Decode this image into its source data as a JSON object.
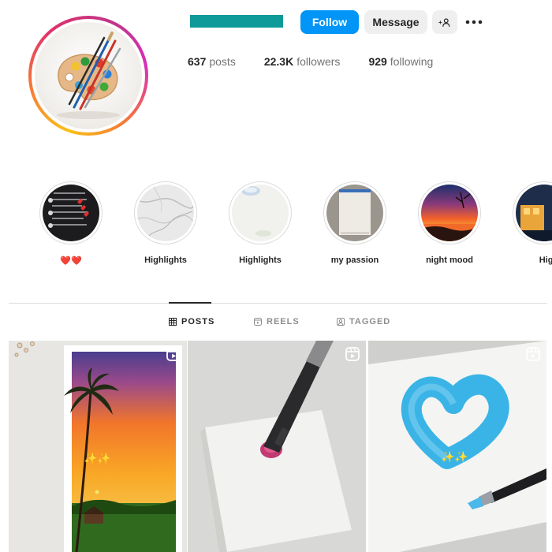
{
  "header": {
    "follow_label": "Follow",
    "message_label": "Message",
    "suggest_icon": "add-user-icon",
    "more_icon": "more-options-icon",
    "avatar_icon": "paint-palette-icon",
    "username_color": "#0f9a9a",
    "accent": "#0095f6"
  },
  "stats": {
    "posts": {
      "value": "637",
      "label": "posts"
    },
    "followers": {
      "value": "22.3K",
      "label": "followers"
    },
    "following": {
      "value": "929",
      "label": "following"
    }
  },
  "highlights": [
    {
      "label": "❤️❤️",
      "cover": "app-screenshot"
    },
    {
      "label": "Highlights",
      "cover": "marble"
    },
    {
      "label": "Highlights",
      "cover": "paint-jar"
    },
    {
      "label": "my passion",
      "cover": "notebook"
    },
    {
      "label": "night mood",
      "cover": "sunset"
    },
    {
      "label": "Highli",
      "cover": "night-scene"
    }
  ],
  "tabs": [
    {
      "label": "POSTS",
      "icon": "grid-icon",
      "active": true
    },
    {
      "label": "REELS",
      "icon": "reels-icon",
      "active": false
    },
    {
      "label": "TAGGED",
      "icon": "tagged-icon",
      "active": false
    }
  ],
  "posts": [
    {
      "type": "reel",
      "caption_overlay": "✨✨",
      "subject": "palm-tree-sunset-painting"
    },
    {
      "type": "reel",
      "caption_overlay": "",
      "subject": "brush-on-canvas"
    },
    {
      "type": "reel",
      "caption_overlay": "✨✨",
      "subject": "blue-heart-painting"
    }
  ]
}
